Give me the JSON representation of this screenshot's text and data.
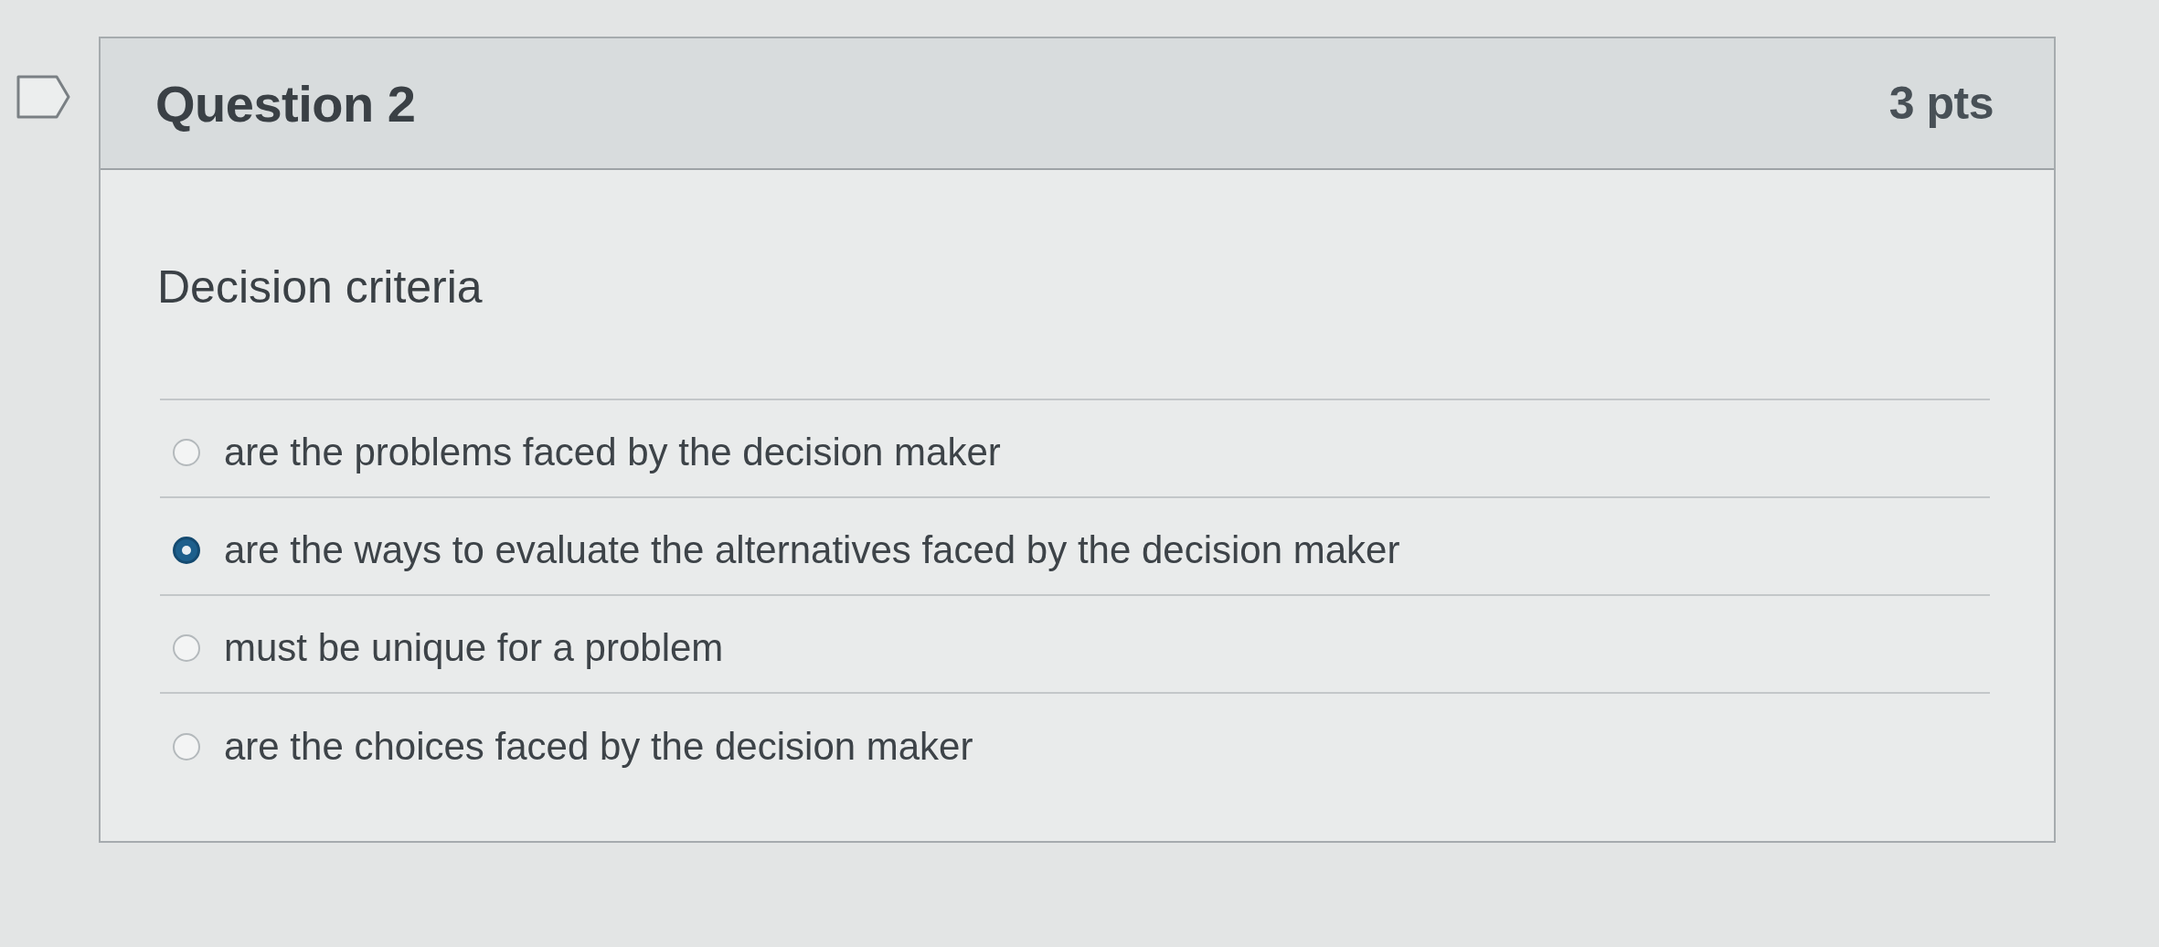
{
  "question": {
    "flagged": false,
    "title": "Question 2",
    "points": "3 pts",
    "text": "Decision criteria",
    "options": [
      {
        "label": "are the problems faced by the decision maker",
        "selected": false
      },
      {
        "label": "are the ways to evaluate the alternatives faced by the decision maker",
        "selected": true
      },
      {
        "label": "must be unique for a problem",
        "selected": false
      },
      {
        "label": "are the choices faced by the decision maker",
        "selected": false
      }
    ]
  }
}
